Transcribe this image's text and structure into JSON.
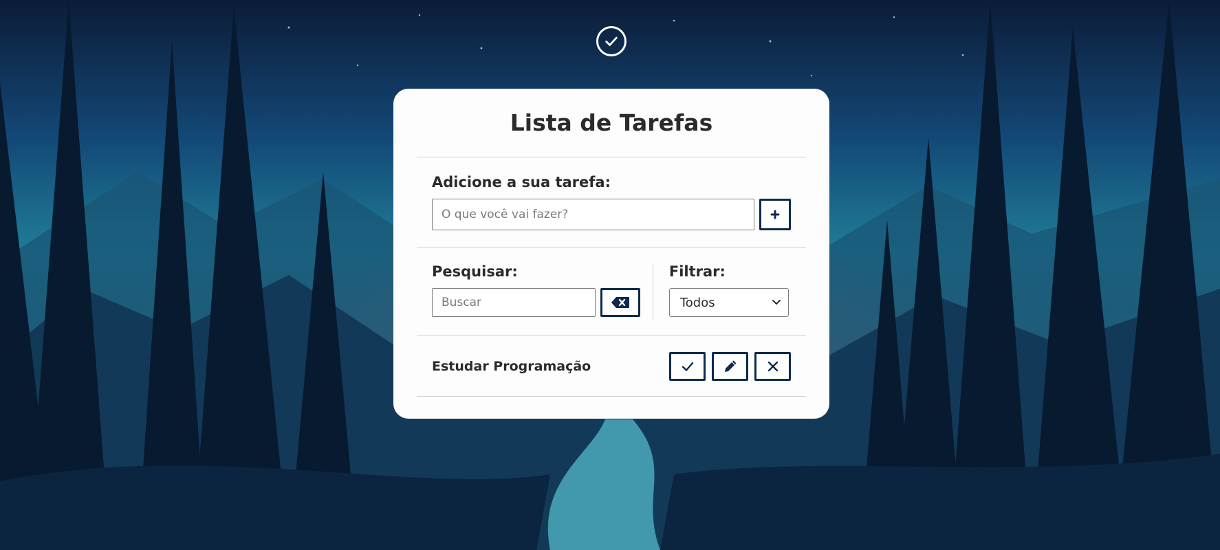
{
  "app": {
    "title": "Lista de Tarefas"
  },
  "add": {
    "label": "Adicione a sua tarefa:",
    "input_placeholder": "O que você vai fazer?",
    "input_value": "",
    "add_button_icon": "plus-icon"
  },
  "search": {
    "label": "Pesquisar:",
    "input_placeholder": "Buscar",
    "input_value": "",
    "clear_button_icon": "backspace-icon"
  },
  "filter": {
    "label": "Filtrar:",
    "selected": "Todos"
  },
  "todos": [
    {
      "text": "Estudar Programação",
      "actions": [
        "check-icon",
        "pencil-icon",
        "close-icon"
      ]
    }
  ],
  "colors": {
    "accent": "#0d2a4d",
    "card_background": "#fdfdfd",
    "text": "#2b2b2b"
  }
}
